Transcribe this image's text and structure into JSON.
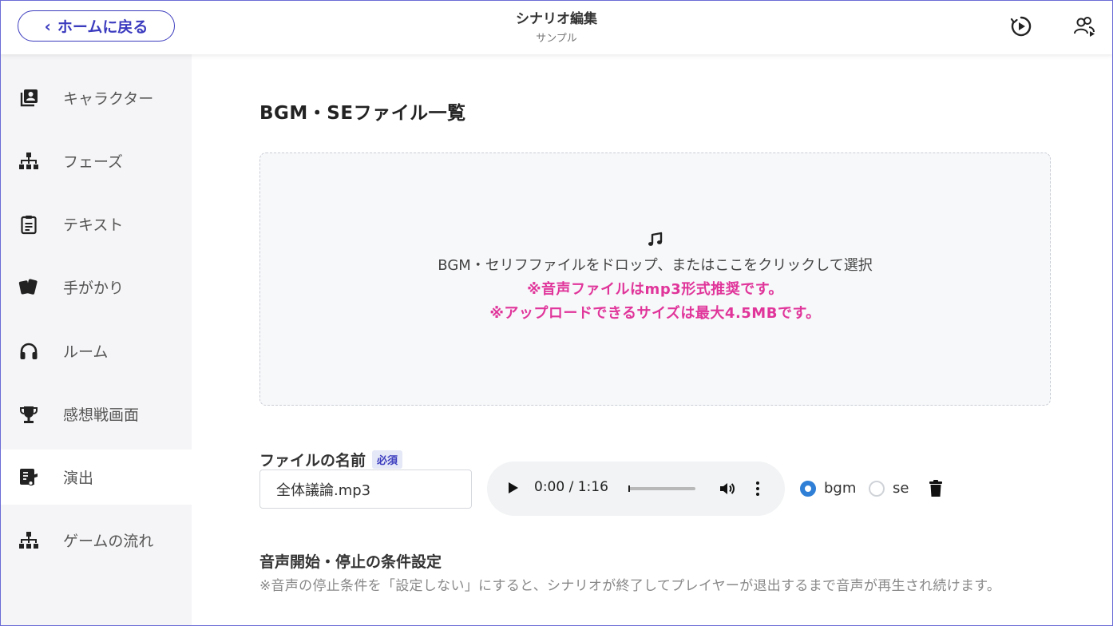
{
  "header": {
    "home_label": "ホームに戻る",
    "title": "シナリオ編集",
    "subtitle": "サンプル",
    "icons": [
      "play-circle-icon",
      "users-icon"
    ]
  },
  "sidebar": {
    "items": [
      {
        "label": "キャラクター",
        "icon": "character-icon",
        "active": false
      },
      {
        "label": "フェーズ",
        "icon": "sitemap-icon",
        "active": false
      },
      {
        "label": "テキスト",
        "icon": "clipboard-icon",
        "active": false
      },
      {
        "label": "手がかり",
        "icon": "cards-icon",
        "active": false
      },
      {
        "label": "ルーム",
        "icon": "headphones-icon",
        "active": false
      },
      {
        "label": "感想戦画面",
        "icon": "trophy-icon",
        "active": false
      },
      {
        "label": "演出",
        "icon": "music-board-icon",
        "active": true
      },
      {
        "label": "ゲームの流れ",
        "icon": "sitemap-icon",
        "active": false
      }
    ]
  },
  "main": {
    "title": "BGM・SEファイル一覧",
    "dropzone": {
      "text": "BGM・セリフファイルをドロップ、またはここをクリックして選択",
      "warning1": "※音声ファイルはmp3形式推奨です。",
      "warning2": "※アップロードできるサイズは最大4.5MBです。"
    },
    "file": {
      "label": "ファイルの名前",
      "required": "必須",
      "value": "全体議論.mp3",
      "audio_time": "0:00 / 1:16",
      "radio_bgm": "bgm",
      "radio_se": "se",
      "selected": "bgm"
    },
    "condition": {
      "title": "音声開始・停止の条件設定",
      "note": "※音声の停止条件を「設定しない」にすると、シナリオが終了してプレイヤーが退出するまで音声が再生され続けます。"
    }
  },
  "colors": {
    "accent": "#3b3bbf",
    "warning": "#e0359a",
    "radio": "#2f7fd6"
  }
}
